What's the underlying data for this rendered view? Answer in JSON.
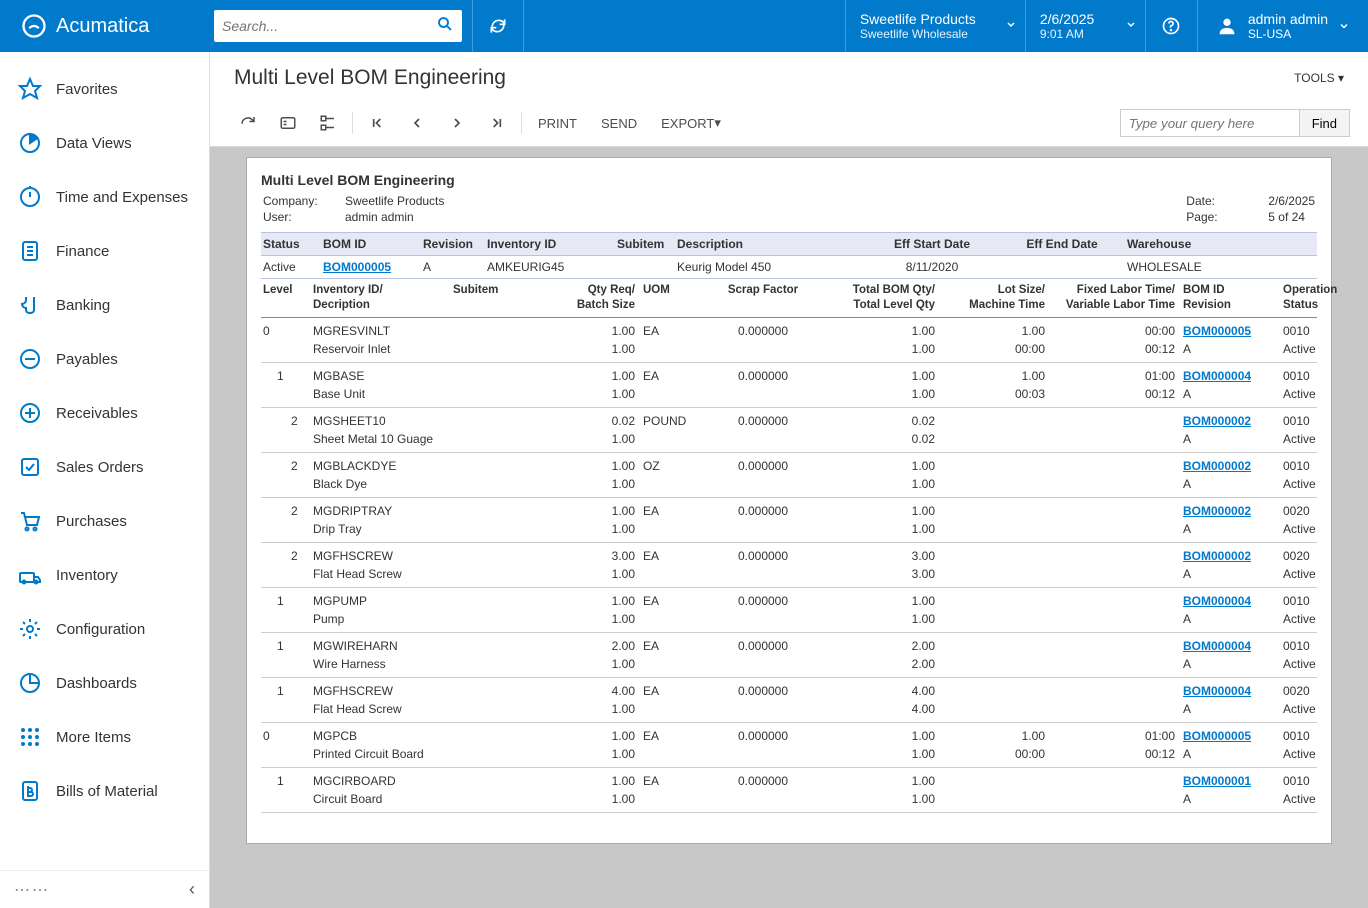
{
  "brand": "Acumatica",
  "search": {
    "placeholder": "Search..."
  },
  "company": {
    "line1": "Sweetlife Products",
    "line2": "Sweetlife Wholesale"
  },
  "datetime": {
    "line1": "2/6/2025",
    "line2": "9:01 AM"
  },
  "user": {
    "line1": "admin admin",
    "line2": "SL-USA"
  },
  "page_title": "Multi Level BOM Engineering",
  "tools_label": "TOOLS",
  "toolbar": {
    "print": "PRINT",
    "send": "SEND",
    "export": "EXPORT"
  },
  "query": {
    "placeholder": "Type your query here",
    "find": "Find"
  },
  "sidebar": [
    {
      "label": "Favorites"
    },
    {
      "label": "Data Views"
    },
    {
      "label": "Time and Expenses"
    },
    {
      "label": "Finance"
    },
    {
      "label": "Banking"
    },
    {
      "label": "Payables"
    },
    {
      "label": "Receivables"
    },
    {
      "label": "Sales Orders"
    },
    {
      "label": "Purchases"
    },
    {
      "label": "Inventory"
    },
    {
      "label": "Configuration"
    },
    {
      "label": "Dashboards"
    },
    {
      "label": "More Items"
    },
    {
      "label": "Bills of Material"
    }
  ],
  "report": {
    "title": "Multi Level BOM Engineering",
    "company_label": "Company:",
    "company": "Sweetlife Products",
    "user_label": "User:",
    "user": "admin admin",
    "date_label": "Date:",
    "date": "2/6/2025",
    "page_label": "Page:",
    "page": "5 of 24",
    "hdr": {
      "status": "Status",
      "bom": "BOM ID",
      "rev": "Revision",
      "inv": "Inventory ID",
      "sub": "Subitem",
      "desc": "Description",
      "eff_start": "Eff Start Date",
      "eff_end": "Eff End Date",
      "wh": "Warehouse"
    },
    "main": {
      "status": "Active",
      "bom": "BOM000005",
      "rev": "A",
      "inv": "AMKEURIG45",
      "desc": "Keurig Model 450",
      "eff_start": "8/11/2020",
      "wh": "WHOLESALE"
    },
    "sub_hdr": {
      "level": "Level",
      "inv": "Inventory ID/\nDecription",
      "sub": "Subitem",
      "qty": "Qty Req/\nBatch Size",
      "uom": "UOM",
      "scrap": "Scrap Factor",
      "totbom": "Total BOM Qty/\nTotal Level Qty",
      "lot": "Lot Size/\nMachine Time",
      "labor": "Fixed Labor Time/\nVariable Labor Time",
      "bomrev": "BOM ID\nRevision",
      "op": "Operation\nStatus"
    },
    "rows": [
      {
        "level": "0",
        "ind": 0,
        "inv": "MGRESVINLT",
        "desc": "Reservoir Inlet",
        "qty": "1.00",
        "batch": "1.00",
        "uom": "EA",
        "scrap": "0.000000",
        "tb1": "1.00",
        "tb2": "1.00",
        "lot": "1.00",
        "mt": "00:00",
        "fl": "00:00",
        "vl": "00:12",
        "bom": "BOM000005",
        "rev": "A",
        "op": "0010",
        "st": "Active"
      },
      {
        "level": "1",
        "ind": 1,
        "inv": "MGBASE",
        "desc": "Base Unit",
        "qty": "1.00",
        "batch": "1.00",
        "uom": "EA",
        "scrap": "0.000000",
        "tb1": "1.00",
        "tb2": "1.00",
        "lot": "1.00",
        "mt": "00:03",
        "fl": "01:00",
        "vl": "00:12",
        "bom": "BOM000004",
        "rev": "A",
        "op": "0010",
        "st": "Active"
      },
      {
        "level": "2",
        "ind": 2,
        "inv": "MGSHEET10",
        "desc": "Sheet Metal 10 Guage",
        "qty": "0.02",
        "batch": "1.00",
        "uom": "POUND",
        "scrap": "0.000000",
        "tb1": "0.02",
        "tb2": "0.02",
        "lot": "",
        "mt": "",
        "fl": "",
        "vl": "",
        "bom": "BOM000002",
        "rev": "A",
        "op": "0010",
        "st": "Active"
      },
      {
        "level": "2",
        "ind": 2,
        "inv": "MGBLACKDYE",
        "desc": "Black Dye",
        "qty": "1.00",
        "batch": "1.00",
        "uom": "OZ",
        "scrap": "0.000000",
        "tb1": "1.00",
        "tb2": "1.00",
        "lot": "",
        "mt": "",
        "fl": "",
        "vl": "",
        "bom": "BOM000002",
        "rev": "A",
        "op": "0010",
        "st": "Active"
      },
      {
        "level": "2",
        "ind": 2,
        "inv": "MGDRIPTRAY",
        "desc": "Drip Tray",
        "qty": "1.00",
        "batch": "1.00",
        "uom": "EA",
        "scrap": "0.000000",
        "tb1": "1.00",
        "tb2": "1.00",
        "lot": "",
        "mt": "",
        "fl": "",
        "vl": "",
        "bom": "BOM000002",
        "rev": "A",
        "op": "0020",
        "st": "Active"
      },
      {
        "level": "2",
        "ind": 2,
        "inv": "MGFHSCREW",
        "desc": "Flat Head Screw",
        "qty": "3.00",
        "batch": "1.00",
        "uom": "EA",
        "scrap": "0.000000",
        "tb1": "3.00",
        "tb2": "3.00",
        "lot": "",
        "mt": "",
        "fl": "",
        "vl": "",
        "bom": "BOM000002",
        "rev": "A",
        "op": "0020",
        "st": "Active"
      },
      {
        "level": "1",
        "ind": 1,
        "inv": "MGPUMP",
        "desc": "Pump",
        "qty": "1.00",
        "batch": "1.00",
        "uom": "EA",
        "scrap": "0.000000",
        "tb1": "1.00",
        "tb2": "1.00",
        "lot": "",
        "mt": "",
        "fl": "",
        "vl": "",
        "bom": "BOM000004",
        "rev": "A",
        "op": "0010",
        "st": "Active"
      },
      {
        "level": "1",
        "ind": 1,
        "inv": "MGWIREHARN",
        "desc": "Wire Harness",
        "qty": "2.00",
        "batch": "1.00",
        "uom": "EA",
        "scrap": "0.000000",
        "tb1": "2.00",
        "tb2": "2.00",
        "lot": "",
        "mt": "",
        "fl": "",
        "vl": "",
        "bom": "BOM000004",
        "rev": "A",
        "op": "0010",
        "st": "Active"
      },
      {
        "level": "1",
        "ind": 1,
        "inv": "MGFHSCREW",
        "desc": "Flat Head Screw",
        "qty": "4.00",
        "batch": "1.00",
        "uom": "EA",
        "scrap": "0.000000",
        "tb1": "4.00",
        "tb2": "4.00",
        "lot": "",
        "mt": "",
        "fl": "",
        "vl": "",
        "bom": "BOM000004",
        "rev": "A",
        "op": "0020",
        "st": "Active"
      },
      {
        "level": "0",
        "ind": 0,
        "inv": "MGPCB",
        "desc": "Printed Circuit Board",
        "qty": "1.00",
        "batch": "1.00",
        "uom": "EA",
        "scrap": "0.000000",
        "tb1": "1.00",
        "tb2": "1.00",
        "lot": "1.00",
        "mt": "00:00",
        "fl": "01:00",
        "vl": "00:12",
        "bom": "BOM000005",
        "rev": "A",
        "op": "0010",
        "st": "Active"
      },
      {
        "level": "1",
        "ind": 1,
        "inv": "MGCIRBOARD",
        "desc": "Circuit Board",
        "qty": "1.00",
        "batch": "1.00",
        "uom": "EA",
        "scrap": "0.000000",
        "tb1": "1.00",
        "tb2": "1.00",
        "lot": "",
        "mt": "",
        "fl": "",
        "vl": "",
        "bom": "BOM000001",
        "rev": "A",
        "op": "0010",
        "st": "Active"
      }
    ]
  }
}
